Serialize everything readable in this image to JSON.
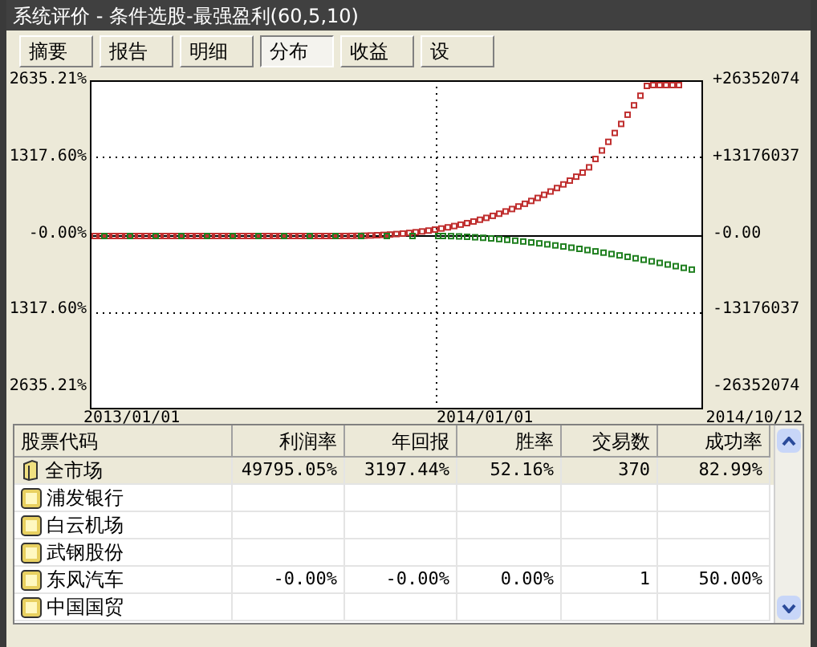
{
  "window": {
    "title": "系统评价 - 条件选股-最强盈利(60,5,10)"
  },
  "tabs": [
    {
      "label": "摘要",
      "selected": false
    },
    {
      "label": "报告",
      "selected": false
    },
    {
      "label": "明细",
      "selected": false
    },
    {
      "label": "分布",
      "selected": true
    },
    {
      "label": "收益",
      "selected": false
    },
    {
      "label": "设",
      "selected": false
    }
  ],
  "chart": {
    "left_axis": [
      "2635.21%",
      "1317.60%",
      "-0.00%",
      "1317.60%",
      "2635.21%"
    ],
    "right_axis": [
      "+26352074",
      "+13176037",
      "-0.00",
      "-13176037",
      "-26352074"
    ],
    "x_labels": [
      "2013/01/01",
      "2014/01/01",
      "2014/10/12"
    ]
  },
  "table": {
    "columns": [
      "股票代码",
      "利润率",
      "年回报",
      "胜率",
      "交易数",
      "成功率"
    ],
    "rows": [
      {
        "kind": "market",
        "selected": true,
        "cells": [
          "全市场",
          "49795.05%",
          "3197.44%",
          "52.16%",
          "370",
          "82.99%"
        ]
      },
      {
        "kind": "stock",
        "selected": false,
        "cells": [
          "浦发银行"
        ]
      },
      {
        "kind": "stock",
        "selected": false,
        "cells": [
          "白云机场"
        ]
      },
      {
        "kind": "stock",
        "selected": false,
        "cells": [
          "武钢股份"
        ]
      },
      {
        "kind": "stock",
        "selected": false,
        "cells": [
          "东风汽车",
          "-0.00%",
          "-0.00%",
          "0.00%",
          "1",
          "50.00%"
        ]
      },
      {
        "kind": "stock",
        "selected": false,
        "cells": [
          "中国国贸"
        ]
      }
    ]
  }
}
